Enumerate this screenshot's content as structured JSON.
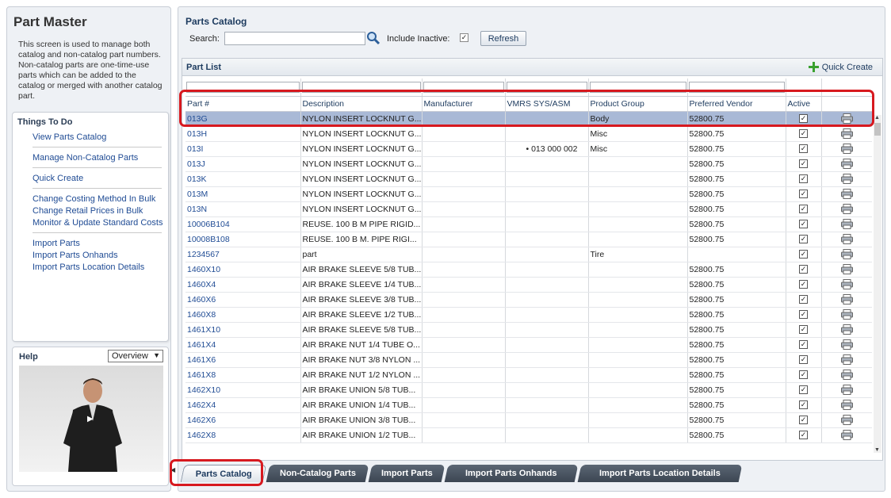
{
  "left": {
    "title": "Part Master",
    "description": "This screen is used to manage both catalog and non-catalog part numbers. Non-catalog parts are one-time-use parts which can be added to the catalog or merged with another catalog part.",
    "things_to_do": {
      "title": "Things To Do",
      "groups": [
        [
          "View Parts Catalog"
        ],
        [
          "Manage Non-Catalog Parts"
        ],
        [
          "Quick Create"
        ],
        [
          "Change Costing Method In Bulk",
          "Change Retail Prices in Bulk",
          "Monitor & Update Standard Costs"
        ],
        [
          "Import Parts",
          "Import Parts Onhands",
          "Import Parts Location Details"
        ]
      ]
    },
    "help": {
      "title": "Help",
      "selected": "Overview"
    }
  },
  "catalog": {
    "title": "Parts Catalog",
    "search_label": "Search:",
    "search_value": "",
    "include_inactive_label": "Include Inactive:",
    "include_inactive_checked": true,
    "refresh_label": "Refresh"
  },
  "part_list": {
    "title": "Part List",
    "quick_create_label": "Quick Create",
    "columns": [
      "Part #",
      "Description",
      "Manufacturer",
      "VMRS SYS/ASM",
      "Product Group",
      "Preferred Vendor",
      "Active",
      ""
    ],
    "rows": [
      {
        "part": "013G",
        "desc": "NYLON INSERT LOCKNUT G...",
        "mfr": "",
        "vmrs": "",
        "group": "Body",
        "vendor": "52800.75",
        "active": true,
        "selected": true
      },
      {
        "part": "013H",
        "desc": "NYLON INSERT LOCKNUT G...",
        "mfr": "",
        "vmrs": "",
        "group": "Misc",
        "vendor": "52800.75",
        "active": true
      },
      {
        "part": "013I",
        "desc": "NYLON INSERT LOCKNUT G...",
        "mfr": "",
        "vmrs": "013 000 002",
        "group": "Misc",
        "vendor": "52800.75",
        "active": true
      },
      {
        "part": "013J",
        "desc": "NYLON INSERT LOCKNUT G...",
        "mfr": "",
        "vmrs": "",
        "group": "",
        "vendor": "52800.75",
        "active": true
      },
      {
        "part": "013K",
        "desc": "NYLON INSERT LOCKNUT G...",
        "mfr": "",
        "vmrs": "",
        "group": "",
        "vendor": "52800.75",
        "active": true
      },
      {
        "part": "013M",
        "desc": "NYLON INSERT LOCKNUT G...",
        "mfr": "",
        "vmrs": "",
        "group": "",
        "vendor": "52800.75",
        "active": true
      },
      {
        "part": "013N",
        "desc": "NYLON INSERT LOCKNUT G...",
        "mfr": "",
        "vmrs": "",
        "group": "",
        "vendor": "52800.75",
        "active": true
      },
      {
        "part": "10006B104",
        "desc": "REUSE. 100 B M PIPE RIGID...",
        "mfr": "",
        "vmrs": "",
        "group": "",
        "vendor": "52800.75",
        "active": true
      },
      {
        "part": "10008B108",
        "desc": "REUSE. 100 B M. PIPE RIGI...",
        "mfr": "",
        "vmrs": "",
        "group": "",
        "vendor": "52800.75",
        "active": true
      },
      {
        "part": "1234567",
        "desc": "part",
        "mfr": "",
        "vmrs": "",
        "group": "Tire",
        "vendor": "",
        "active": true
      },
      {
        "part": "1460X10",
        "desc": "AIR BRAKE SLEEVE 5/8 TUB...",
        "mfr": "",
        "vmrs": "",
        "group": "",
        "vendor": "52800.75",
        "active": true
      },
      {
        "part": "1460X4",
        "desc": "AIR BRAKE SLEEVE 1/4 TUB...",
        "mfr": "",
        "vmrs": "",
        "group": "",
        "vendor": "52800.75",
        "active": true
      },
      {
        "part": "1460X6",
        "desc": "AIR BRAKE SLEEVE 3/8 TUB...",
        "mfr": "",
        "vmrs": "",
        "group": "",
        "vendor": "52800.75",
        "active": true
      },
      {
        "part": "1460X8",
        "desc": "AIR BRAKE SLEEVE 1/2 TUB...",
        "mfr": "",
        "vmrs": "",
        "group": "",
        "vendor": "52800.75",
        "active": true
      },
      {
        "part": "1461X10",
        "desc": "AIR BRAKE SLEEVE 5/8 TUB...",
        "mfr": "",
        "vmrs": "",
        "group": "",
        "vendor": "52800.75",
        "active": true
      },
      {
        "part": "1461X4",
        "desc": "AIR BRAKE NUT 1/4 TUBE O...",
        "mfr": "",
        "vmrs": "",
        "group": "",
        "vendor": "52800.75",
        "active": true
      },
      {
        "part": "1461X6",
        "desc": "AIR BRAKE NUT 3/8 NYLON ...",
        "mfr": "",
        "vmrs": "",
        "group": "",
        "vendor": "52800.75",
        "active": true
      },
      {
        "part": "1461X8",
        "desc": "AIR BRAKE NUT 1/2 NYLON ...",
        "mfr": "",
        "vmrs": "",
        "group": "",
        "vendor": "52800.75",
        "active": true
      },
      {
        "part": "1462X10",
        "desc": "AIR BRAKE UNION 5/8 TUB...",
        "mfr": "",
        "vmrs": "",
        "group": "",
        "vendor": "52800.75",
        "active": true
      },
      {
        "part": "1462X4",
        "desc": "AIR BRAKE UNION 1/4 TUB...",
        "mfr": "",
        "vmrs": "",
        "group": "",
        "vendor": "52800.75",
        "active": true
      },
      {
        "part": "1462X6",
        "desc": "AIR BRAKE UNION 3/8 TUB...",
        "mfr": "",
        "vmrs": "",
        "group": "",
        "vendor": "52800.75",
        "active": true
      },
      {
        "part": "1462X8",
        "desc": "AIR BRAKE UNION 1/2 TUB...",
        "mfr": "",
        "vmrs": "",
        "group": "",
        "vendor": "52800.75",
        "active": true
      }
    ]
  },
  "tabs": [
    {
      "label": "Parts Catalog",
      "active": true
    },
    {
      "label": "Non-Catalog Parts"
    },
    {
      "label": "Import Parts"
    },
    {
      "label": "Import Parts Onhands"
    },
    {
      "label": "Import Parts Location Details"
    }
  ],
  "colors": {
    "highlight_box": "#d7191f",
    "selected_row": "#a9b9d6",
    "link": "#1f4b94"
  }
}
